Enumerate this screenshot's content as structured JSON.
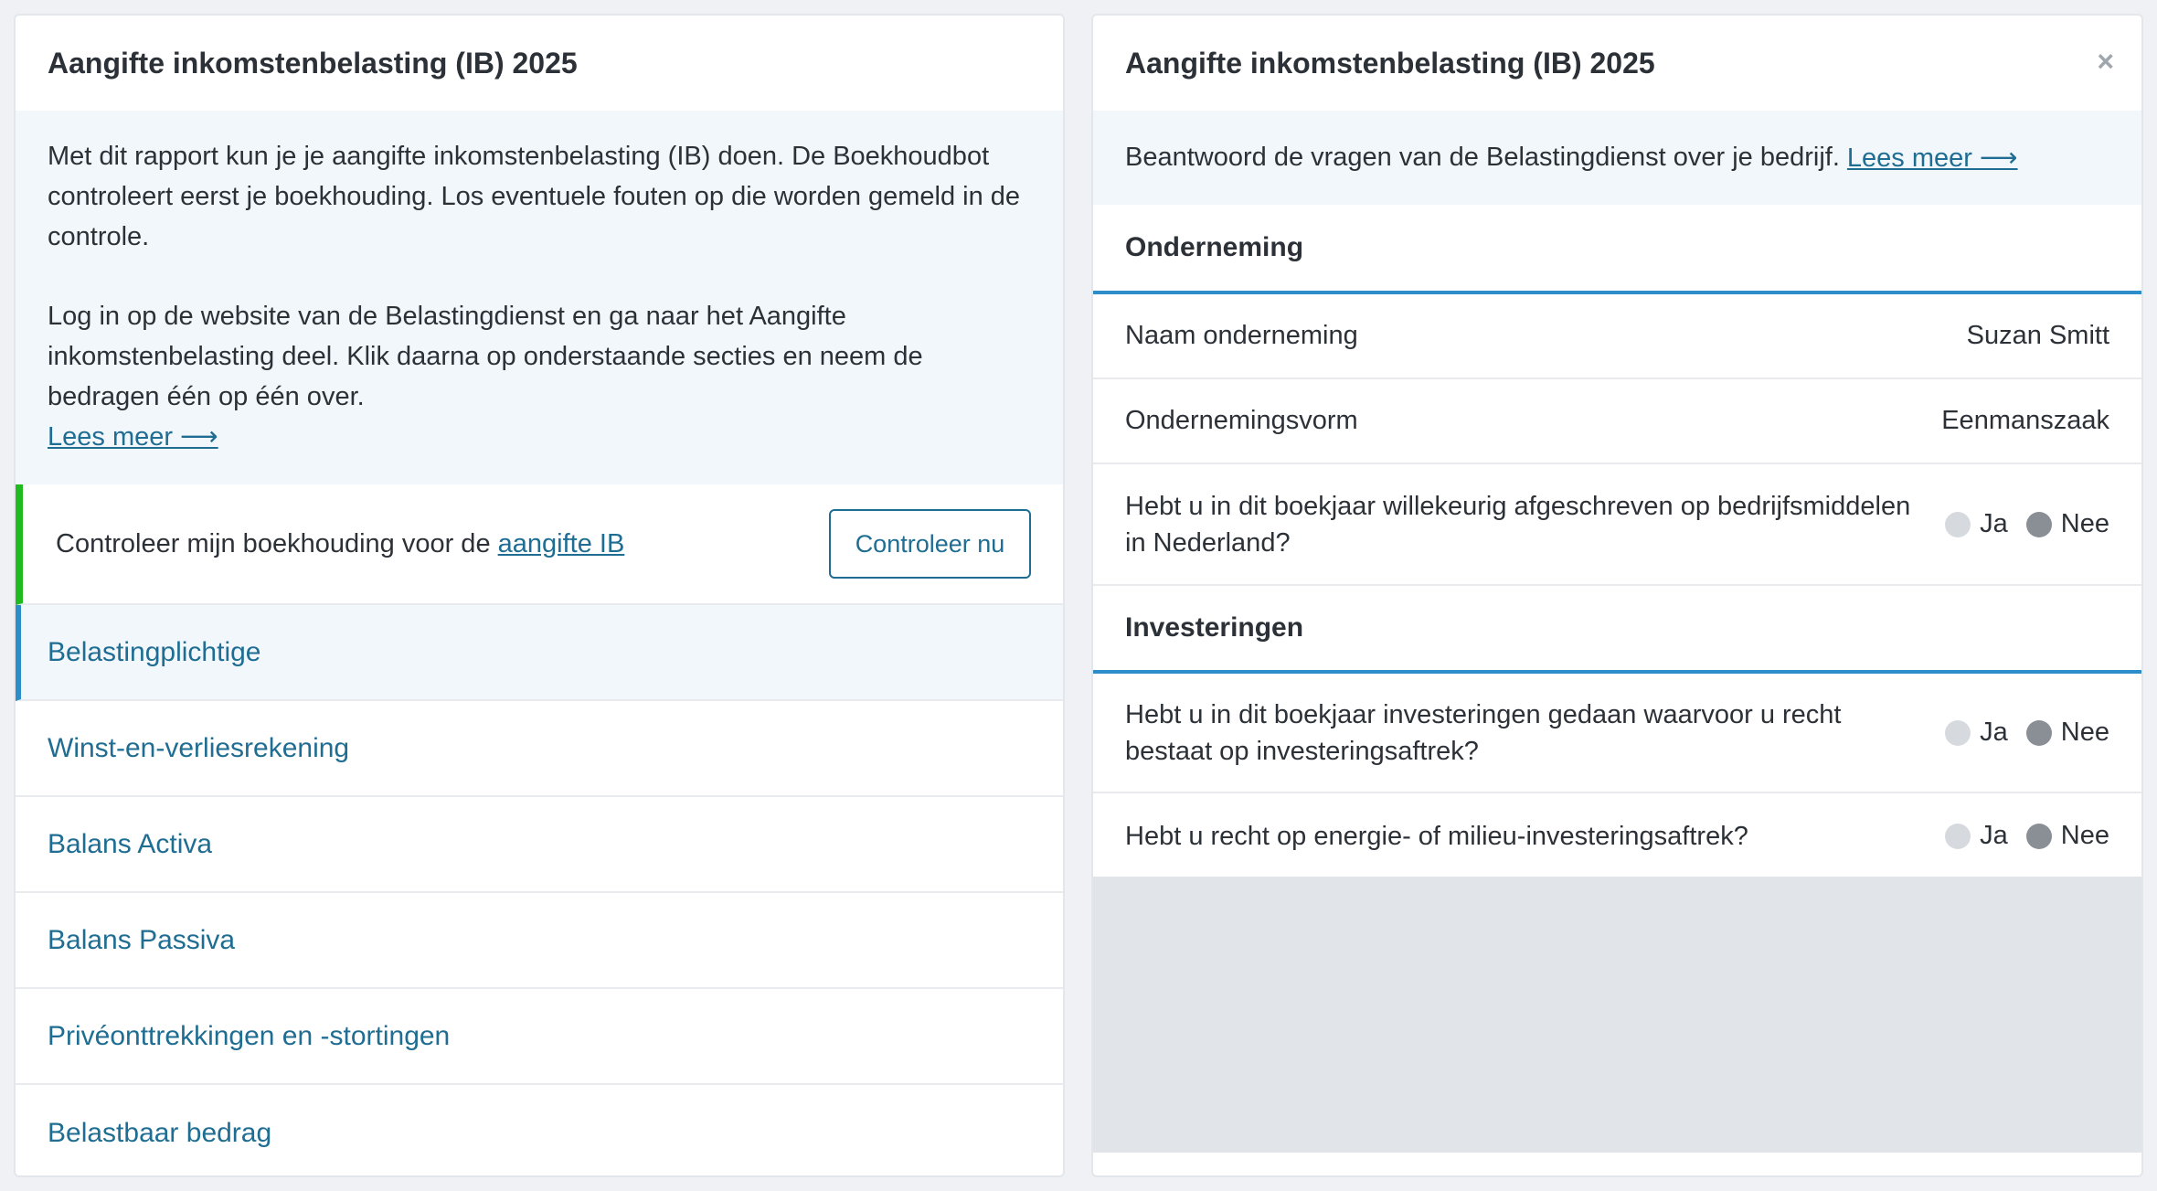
{
  "left": {
    "title": "Aangifte inkomstenbelasting (IB) 2025",
    "intro_p1": "Met dit rapport kun je je aangifte inkomstenbelasting (IB) doen. De Boekhoudbot controleert eerst je boekhouding. Los eventuele fouten op die worden gemeld in de controle.",
    "intro_p2": "Log in op de website van de Belastingdienst en ga naar het Aangifte inkomstenbelasting deel. Klik daarna op onderstaande secties en neem de bedragen één op één over.",
    "read_more": "Lees meer ⟶",
    "check": {
      "text": "Controleer mijn boekhouding voor de ",
      "link": "aangifte IB",
      "button": "Controleer nu",
      "accent": "#1fbb1f"
    },
    "nav": [
      {
        "label": "Belastingplichtige",
        "active": true
      },
      {
        "label": "Winst-en-verliesrekening"
      },
      {
        "label": "Balans Activa"
      },
      {
        "label": "Balans Passiva"
      },
      {
        "label": "Privéonttrekkingen en -stortingen"
      },
      {
        "label": "Belastbaar bedrag"
      }
    ]
  },
  "right": {
    "title": "Aangifte inkomstenbelasting (IB) 2025",
    "close": "×",
    "intro": "Beantwoord de vragen van de Belastingdienst over je bedrijf.",
    "read_more": "Lees meer ⟶",
    "sections": {
      "onderneming": {
        "title": "Onderneming",
        "naam_label": "Naam onderneming",
        "naam_value": "Suzan Smitt",
        "vorm_label": "Ondernemingsvorm",
        "vorm_value": "Eenmanszaak",
        "q1": "Hebt u in dit boekjaar willekeurig afgeschreven op bedrijfsmiddelen in Nederland?"
      },
      "investeringen": {
        "title": "Investeringen",
        "q1": "Hebt u in dit boekjaar investeringen gedaan waarvoor u recht bestaat op investeringsaftrek?",
        "q2": "Hebt u recht op energie- of milieu-investeringsaftrek?"
      }
    },
    "yes": "Ja",
    "no": "Nee",
    "accent": "#2d8dc9"
  }
}
